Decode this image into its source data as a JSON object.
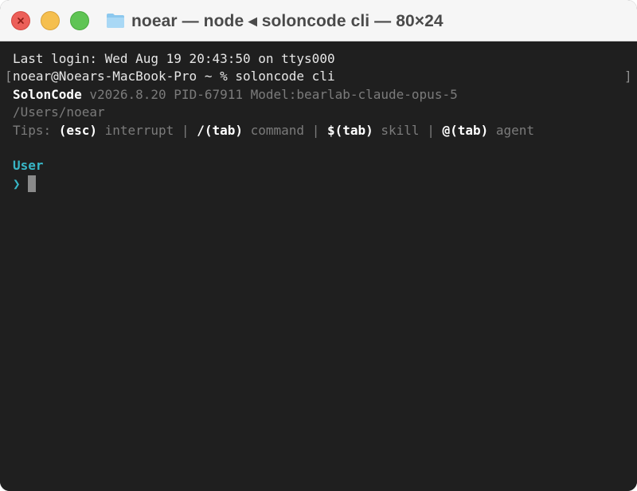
{
  "window": {
    "title": "noear — node ◂ soloncode cli — 80×24",
    "folder_icon": "folder-icon"
  },
  "colors": {
    "background": "#1f1f1f",
    "text": "#e6e6e6",
    "dim": "#7b7b7b",
    "accent": "#38b6c6"
  },
  "terminal": {
    "last_login": "Last login: Wed Aug 19 20:43:50 on ttys000",
    "prompt": "noear@Noears-MacBook-Pro ~ % soloncode cli",
    "bracket_open": "[",
    "bracket_close": "]",
    "app_name": "SolonCode",
    "app_info": " v2026.8.20 PID-67911 Model:bearlab-claude-opus-5",
    "cwd": "/Users/noear",
    "tips": {
      "label": "Tips: ",
      "items": [
        {
          "key": "(esc)",
          "desc": " interrupt"
        },
        {
          "key": "/(tab)",
          "desc": " command"
        },
        {
          "key": "$(tab)",
          "desc": " skill"
        },
        {
          "key": "@(tab)",
          "desc": " agent"
        }
      ],
      "separator": " | "
    },
    "user_label": "User",
    "input_prompt": "❯",
    "input_value": ""
  }
}
